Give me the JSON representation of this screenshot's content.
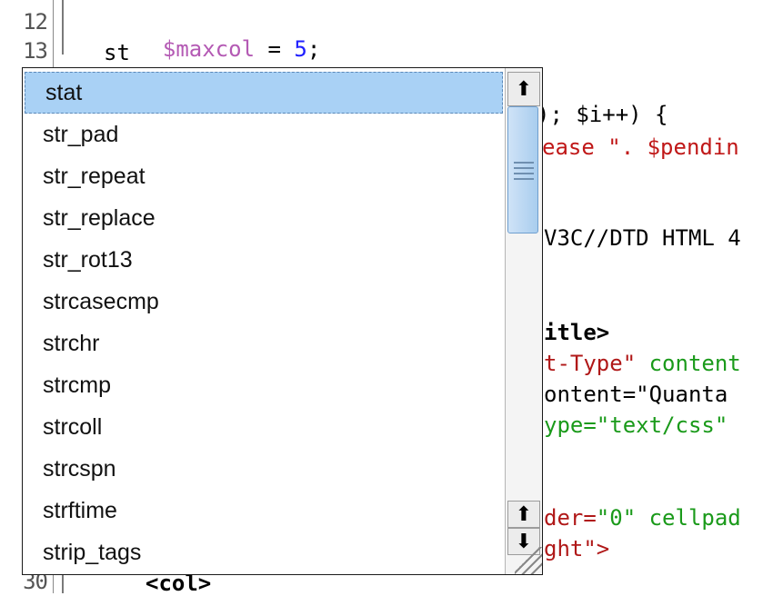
{
  "gutter": {
    "line_numbers": [
      "12",
      "13",
      "30"
    ]
  },
  "code": {
    "line12": {
      "var": "$maxcol",
      "op": " = ",
      "num": "5",
      "end": ";"
    },
    "line13": "st",
    "frag1": "); $i++) {",
    "frag1_var": "$i",
    "frag2_red": "ease \". $pendin",
    "frag3": "V3C//DTD HTML 4",
    "frag4": "itle>",
    "frag5_attr": "t-Type\"",
    "frag5_str": " content",
    "frag6": "ontent=\"Quanta ",
    "frag7": "ype=\"text/css\" ",
    "frag8_attr": "der=",
    "frag8_str": "\"0\"",
    "frag8_rest": " cellpad",
    "frag9_attr": "ght\">",
    "frag10": "<col>"
  },
  "completion": {
    "selected_index": 0,
    "items": [
      "stat",
      "str_pad",
      "str_repeat",
      "str_replace",
      "str_rot13",
      "strcasecmp",
      "strchr",
      "strcmp",
      "strcoll",
      "strcspn",
      "strftime",
      "strip_tags"
    ],
    "scrollbar": {
      "up_arrow": "⬆",
      "down_arrow": "⬇",
      "up_small": "⬆",
      "position": 0.08
    }
  }
}
